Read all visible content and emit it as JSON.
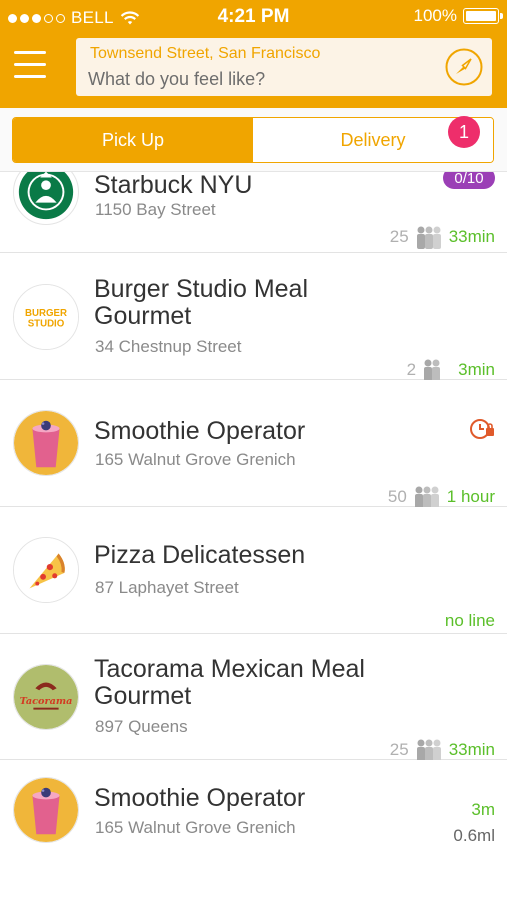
{
  "status_bar": {
    "carrier": "BELL",
    "time": "4:21 PM",
    "battery": "100%"
  },
  "header": {
    "location": "Townsend Street, San Francisco",
    "search_placeholder": "What do you feel like?",
    "icons": [
      "menu-icon",
      "compass-icon"
    ]
  },
  "tabs": {
    "pickup": "Pick Up",
    "delivery": "Delivery",
    "badge": "1"
  },
  "restaurants": [
    {
      "name": "Starbuck NYU",
      "address": "1150 Bay Street",
      "people": "25",
      "wait": "33min",
      "promo": "0/10",
      "logo": "starbucks-logo"
    },
    {
      "name": "Burger Studio Meal Gourmet",
      "address": "34 Chestnup Street",
      "people": "2",
      "wait": "3min",
      "logo": "burger-studio-logo",
      "logo_text_1": "BURGER",
      "logo_text_2": "STUDIO"
    },
    {
      "name": "Smoothie Operator",
      "address": "165 Walnut Grove Grenich",
      "people": "50",
      "wait": "1 hour",
      "logo": "smoothie-logo",
      "status_icon": "alarm-lock-icon"
    },
    {
      "name": "Pizza Delicatessen",
      "address": "87 Laphayet Street",
      "wait": "no line",
      "logo": "pizza-logo"
    },
    {
      "name": "Tacorama Mexican Meal Gourmet",
      "address": "897 Queens",
      "people": "25",
      "wait": "33min",
      "logo": "tacorama-logo",
      "logo_text": "Tacorama"
    },
    {
      "name": "Smoothie Operator",
      "address": "165 Walnut Grove Grenich",
      "wait": "3m",
      "distance": "0.6ml",
      "logo": "smoothie-logo"
    }
  ],
  "colors": {
    "accent": "#f0a500",
    "wait_green": "#5bbf2a",
    "badge_pink": "#ee2e6b",
    "promo_purple": "#9b3fb6"
  }
}
